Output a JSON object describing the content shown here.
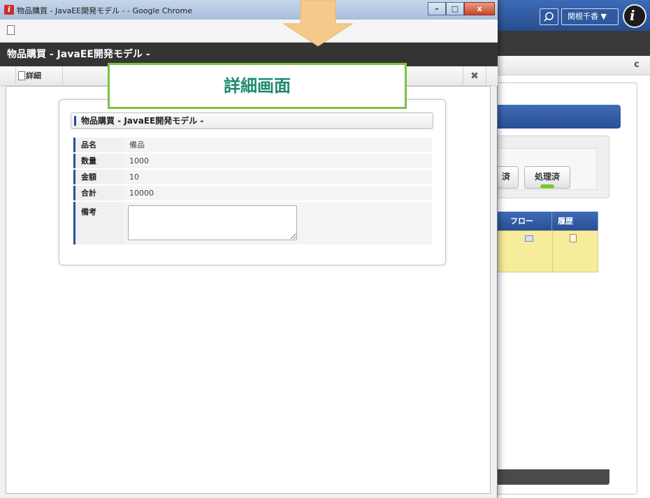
{
  "background": {
    "user_label": "関根千香 ▼",
    "logo_glyph": "i",
    "refresh_glyph": "c",
    "buttons": [
      "済",
      "処理済"
    ],
    "table_headers": [
      "フロー",
      "履歴"
    ]
  },
  "window": {
    "title": "物品購買 - JavaEE開発モデル - - Google Chrome",
    "logo_glyph": "i",
    "controls": [
      "–",
      "□",
      "x"
    ]
  },
  "app": {
    "header_title": "物品購買 - JavaEE開発モデル -",
    "toolbar_detail_label": "詳細",
    "toolbar_close_glyph": "✖"
  },
  "card": {
    "title": "物品購買 - JavaEE開発モデル -",
    "fields": [
      {
        "label": "品名",
        "value": "備品"
      },
      {
        "label": "数量",
        "value": "1000"
      },
      {
        "label": "金額",
        "value": "10"
      },
      {
        "label": "合計",
        "value": "10000"
      },
      {
        "label": "備考",
        "value": ""
      }
    ]
  },
  "callout": {
    "text": "詳細画面"
  },
  "colors": {
    "accent_blue": "#2b4f99",
    "callout_border": "#7cc243",
    "callout_text": "#1e8a6e",
    "arrow_fill": "#f6c889"
  }
}
